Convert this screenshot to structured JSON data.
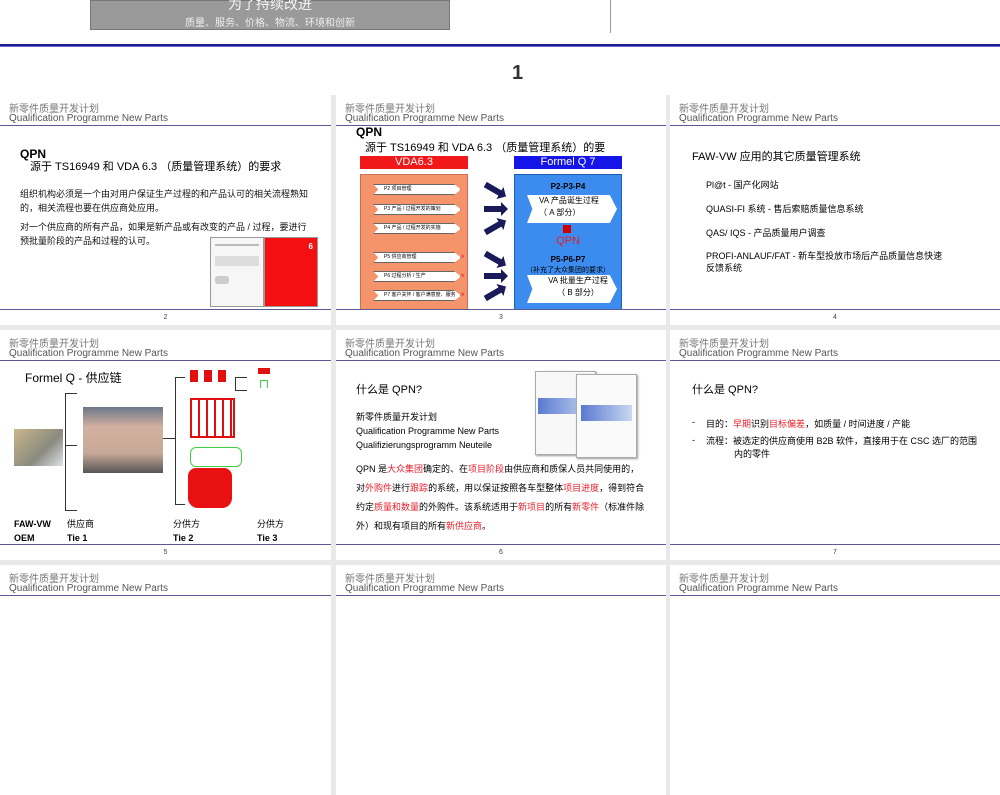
{
  "banner": {
    "title": "为了持续改进",
    "subtitle": "质量、服务、价格、物流、环境和创新"
  },
  "page_number": "1",
  "header": {
    "cn": "新零件质量开发计划",
    "en": "Qualification Programme New Parts"
  },
  "slides": {
    "s2": {
      "num": "2",
      "qpn": "QPN",
      "title": "源于 TS16949 和 VDA 6.3 （质量管理系统）的要求",
      "p1": "组织机构必须是一个由对用户保证生产过程的和产品认可的相关流程熟知的，相关流程也要在供应商处应用。",
      "p2": "对一个供应商的所有产品，如果是新产品或有改变的产品 / 过程，要进行预批量阶段的产品和过程的认可。",
      "doc_red_num": "6"
    },
    "s3": {
      "num": "3",
      "qpn": "QPN",
      "title": "源于 TS16949 和 VDA 6.3 （质量管理系统）的要",
      "left_head": "VDA6.3",
      "right_head": "Formel Q 7",
      "items": [
        "P2 项目管理",
        "P3 产品 / 过程开发的策划",
        "P4 产品 / 过程开发的实施",
        "P5 供应商管理",
        "P6 过程分析 / 生产",
        "P7 客户关怀 / 客户满意度、服务"
      ],
      "star": "*",
      "ra": "P2-P3-P4",
      "va1": "VA 产品诞生过程",
      "va1b": "（ A 部分）",
      "qpn_red": "QPN",
      "rb": "P5-P6-P7",
      "rb_note": "（补充了大众集团的要求）",
      "va2": "VA 批量生产过程",
      "va2b": "（ B 部分）"
    },
    "s4": {
      "num": "4",
      "title": "FAW-VW  应用的其它质量管理系统",
      "items": [
        "Pl@t -  国产化网站",
        "QUASI-FI 系统  -  售后索赔质量信息系统",
        "QAS/ IQS -  产品质量用户调查",
        "PROFI-ANLAUF/FAT -  新车型投放市场后产品质量信息快速反馈系统"
      ]
    },
    "s5": {
      "num": "5",
      "title": "Formel Q -  供应链",
      "labels": [
        {
          "l1": "FAW-VW",
          "l2": "OEM"
        },
        {
          "l1": "供应商",
          "l2": "Tie 1"
        },
        {
          "l1": "分供方",
          "l2": "Tie 2"
        },
        {
          "l1": "分供方",
          "l2": "Tie 3"
        }
      ]
    },
    "s6": {
      "num": "6",
      "title": "什么是 QPN?",
      "n1": "新零件质量开发计划",
      "n2": "Qualification Programme  New Parts",
      "n3": "Qualifizierungsprogramm Neuteile",
      "para": [
        {
          "t": "QPN 是"
        },
        {
          "t": "大众集团",
          "red": true
        },
        {
          "t": "确定的、在"
        },
        {
          "t": "项目阶段",
          "red": true
        },
        {
          "t": "由供应商和质保人员共同使用的，对"
        },
        {
          "t": "外购件",
          "red": true
        },
        {
          "t": "进行"
        },
        {
          "t": "跟踪",
          "red": true
        },
        {
          "t": "的系统，用以保证按照各车型整体"
        },
        {
          "t": "项目进度",
          "red": true
        },
        {
          "t": "，得到符合约定"
        },
        {
          "t": "质量和数量",
          "red": true
        },
        {
          "t": "的外购件。该系统适用于"
        },
        {
          "t": "新项目",
          "red": true
        },
        {
          "t": "的所有"
        },
        {
          "t": "新零件",
          "red": true
        },
        {
          "t": "（标准件除外）和现有项目的所有"
        },
        {
          "t": "新供应商",
          "red": true
        },
        {
          "t": "。"
        }
      ]
    },
    "s7": {
      "num": "7",
      "title": "什么是 QPN?",
      "b1": [
        {
          "t": "目的："
        },
        {
          "t": "早期",
          "red": true
        },
        {
          "t": "识别"
        },
        {
          "t": "目标偏差",
          "red": true
        },
        {
          "t": "，如质量 / 时间进度 / 产能"
        }
      ],
      "b2": "流程：被选定的供应商使用 B2B 软件，直接用于在 CSC 选厂的范围内的零件",
      "dash": "-"
    }
  },
  "colors": {
    "accent_red": "#e8202a",
    "header_line": "#5a5a98",
    "blue": "#1a1aee"
  }
}
